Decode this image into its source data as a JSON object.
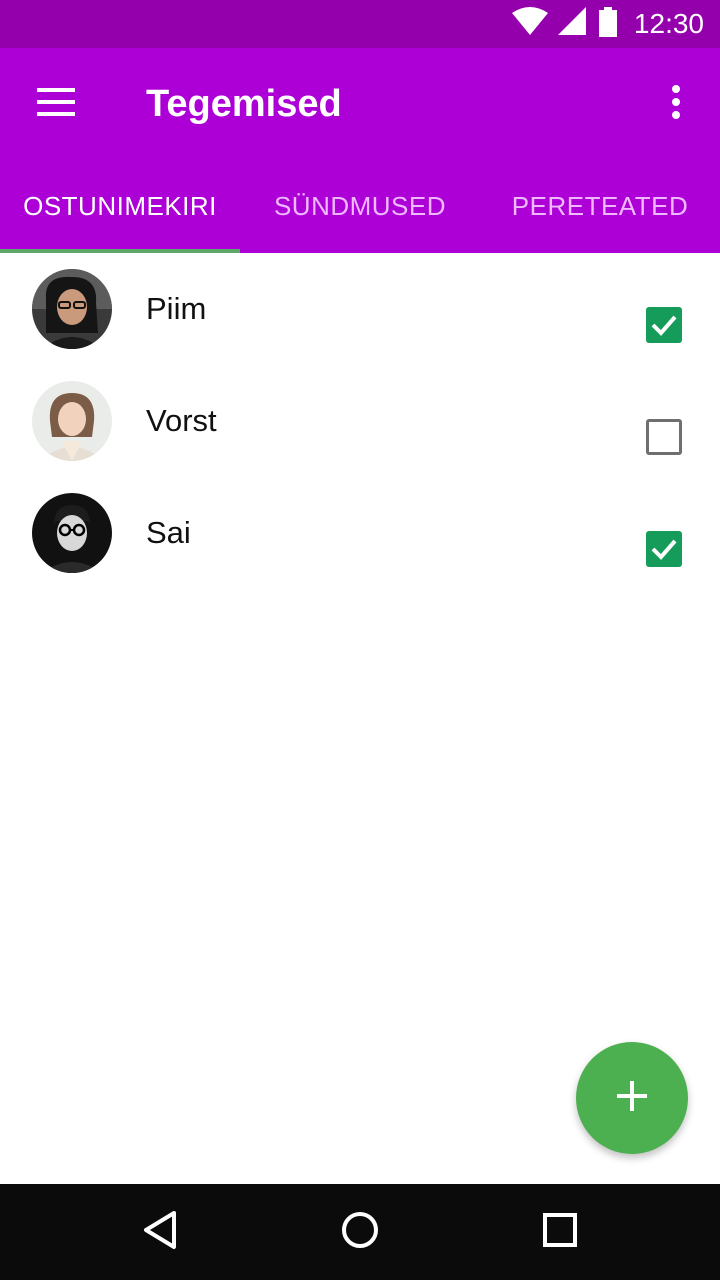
{
  "status_bar": {
    "time": "12:30",
    "icons": [
      "wifi-icon",
      "signal-icon",
      "battery-icon"
    ]
  },
  "app_bar": {
    "title": "Tegemised",
    "menu_icon": "hamburger-menu-icon",
    "overflow_icon": "more-vert-icon"
  },
  "tabs": [
    {
      "label": "OSTUNIMEKIRI",
      "active": true
    },
    {
      "label": "SÜNDMUSED",
      "active": false
    },
    {
      "label": "PERETEATED",
      "active": false
    }
  ],
  "list": {
    "items": [
      {
        "label": "Piim",
        "checked": true
      },
      {
        "label": "Vorst",
        "checked": false
      },
      {
        "label": "Sai",
        "checked": true
      }
    ]
  },
  "fab": {
    "icon": "plus-icon"
  },
  "nav_bar": {
    "icons": [
      "back-icon",
      "home-icon",
      "recents-icon"
    ]
  },
  "colors": {
    "status_bar": "#9500ad",
    "primary": "#ac00d6",
    "tab_indicator": "#5ea66a",
    "checkbox_checked": "#159c5b",
    "fab": "#4caf50",
    "nav_bar": "#0b0b0b"
  }
}
